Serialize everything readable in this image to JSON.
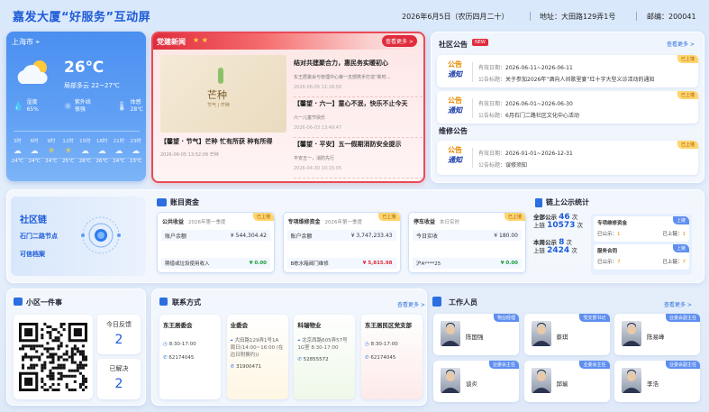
{
  "header": {
    "title": "嘉发大厦“好服务”互动屏",
    "date": "2026年6月5日（农历四月二十）",
    "address": "地址：大田路129弄1号",
    "postcode": "邮编：200041"
  },
  "weather": {
    "city": "上海市",
    "temp": "26℃",
    "desc": "局部多云 22~27℃",
    "stats": [
      {
        "label": "湿度",
        "value": "65%"
      },
      {
        "label": "紫外线",
        "value": "很强"
      },
      {
        "label": "体感",
        "value": "28℃"
      }
    ],
    "hours": [
      {
        "t": "3时",
        "v": "24℃"
      },
      {
        "t": "6时",
        "v": "24℃"
      },
      {
        "t": "9时",
        "v": "24℃"
      },
      {
        "t": "12时",
        "v": "25℃"
      },
      {
        "t": "15时",
        "v": "26℃"
      },
      {
        "t": "18时",
        "v": "26℃"
      },
      {
        "t": "21时",
        "v": "24℃"
      },
      {
        "t": "23时",
        "v": "23℃"
      }
    ]
  },
  "news": {
    "title": "党建新闻",
    "more": "查看更多 >",
    "image_title": "芒种",
    "image_sub": "节气 | 芒种",
    "main_title": "【馨望 · 节气】芒种 忙有所获 种有所得",
    "main_date": "2026-06-05 13:52:09  芒种",
    "items": [
      {
        "title": "结对共建聚合力，惠民务实暖初心",
        "summary": "东王居委会与管理中心第一支部携手打造“新时…",
        "date": "2026-06-05 11:18:50"
      },
      {
        "title": "【馨望 · 六一】童心不泯，快乐不止今天",
        "summary": "六一儿童节快乐",
        "date": "2026-06-03 13:49:47"
      },
      {
        "title": "【馨望 · 平安】五一假期消防安全提示",
        "summary": "平安五一，消防先行",
        "date": "2026-04-30 10:15:05"
      }
    ]
  },
  "notices": {
    "title": "社区公告",
    "badge": "NEW",
    "more": "查看更多 >",
    "icon_top": "公告",
    "icon_bottom": "通知",
    "status": "已上墙",
    "items": [
      {
        "l1": "有效日期：",
        "v1": "2026-06-11~2026-06-11",
        "l2": "公告标题：",
        "v2": "关于参加2026年“酒向人间歌里宴”红十字大型义诊活动的通知"
      },
      {
        "l1": "有效日期：",
        "v1": "2026-06-01~2026-06-30",
        "l2": "公告标题：",
        "v2": "6月石门二路社区文化中心活动"
      }
    ],
    "repair_title": "维修公告",
    "repair": {
      "l1": "有效日期：",
      "v1": "2026-01-01~2026-12-31",
      "l2": "公告标题：",
      "v2": "误修须知"
    }
  },
  "chain": {
    "title": "社区链",
    "line1": "石门二路节点",
    "line2": "可信档案"
  },
  "accounts": {
    "title": "账目资金",
    "status": "已上墙",
    "cards": [
      {
        "name": "公共收益",
        "period": "2026年第一季度",
        "r1l": "账户余额",
        "r1v": "¥ 544,304.42",
        "r2l": "期借或垃圾使用收入",
        "r2v": "¥ 0.00"
      },
      {
        "name": "专项维修资金",
        "period": "2026年第一季度",
        "r1l": "账户余额",
        "r1v": "¥ 3,747,233.43",
        "r2l": "B栋水箱阀门维修",
        "r2v": "¥ 5,815.98"
      },
      {
        "name": "停车收益",
        "period": "本日实时",
        "r1l": "今日实收",
        "r1v": "¥ 180.00",
        "r2l": "沪A****25",
        "r2v": "¥ 0.00"
      }
    ]
  },
  "chainstats": {
    "title": "链上公示统计",
    "total_l": "全部公示",
    "total_n": "46",
    "total_u": "次",
    "total_chain_l": "上链",
    "total_chain_n": "10573",
    "total_chain_u": "次",
    "month_l": "本周公示",
    "month_n": "8",
    "month_u": "次",
    "month_chain_l": "上链",
    "month_chain_n": "2424",
    "month_chain_u": "次",
    "tag": "上链",
    "cards": [
      {
        "name": "专项维修资金",
        "a_l": "已公示：",
        "a_v": "1",
        "b_l": "已上链：",
        "b_v": "1"
      },
      {
        "name": "服务合同",
        "a_l": "已公示：",
        "a_v": "7",
        "b_l": "已上链：",
        "b_v": "7"
      }
    ]
  },
  "oneclick": {
    "title": "小区一件事",
    "today_l": "今日反馈",
    "today_v": "2",
    "done_l": "已解决",
    "done_v": "2"
  },
  "contacts": {
    "title": "联系方式",
    "more": "查看更多 >",
    "items": [
      {
        "name": "东王居委会",
        "time": "8:30-17:00",
        "addr": "",
        "tel": "62174045"
      },
      {
        "name": "业委会",
        "time": "",
        "addr": "大田路129弄1号1A 周日(14:00~16:00 (在边日附换约))",
        "tel": "31900471"
      },
      {
        "name": "科瑞物业",
        "time": "",
        "addr": "北京西路605弄57号1G室 8:30-17:00",
        "tel": "52855572"
      },
      {
        "name": "东王居民区党支部",
        "time": "8:30-17:00",
        "addr": "",
        "tel": "62174045"
      }
    ]
  },
  "staff": {
    "title": "工作人员",
    "more": "查看更多 >",
    "people": [
      {
        "name": "陈国强",
        "role": "物业经理"
      },
      {
        "name": "蔡琪",
        "role": "党支部书记"
      },
      {
        "name": "陈易峰",
        "role": "业委会副主任"
      },
      {
        "name": "谈炎",
        "role": "业委会主任"
      },
      {
        "name": "邱瑜",
        "role": "业委会主任"
      },
      {
        "name": "李浩",
        "role": "业委会副主任"
      }
    ]
  },
  "colors": {
    "primary": "#1d5bd8",
    "red": "#e02c3c",
    "gold": "#ffb300"
  }
}
